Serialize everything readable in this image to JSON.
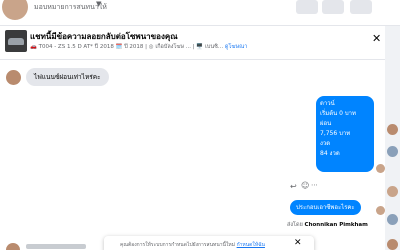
{
  "topbar": {
    "profile_name": "มอบหมายการสนทนาให้",
    "caret": "▼"
  },
  "header": {
    "title": "แชทนี้มีข้อความลอยกลับต่อโซพนาของคุณ",
    "subtitle": "🚗 T004 - ZS 1.5 D AT* ปี 2018 🗓️ ปี 2018 | ◎ เกือบัลงโฆษ ... | 🖥️ เบนซิ...",
    "view_link": "ดูโฆษณา",
    "close_icon": "close-icon"
  },
  "messages": {
    "incoming_1": "ไฟแนนซ์ผ่อนเท่าไหร่คะ",
    "outgoing_lines": [
      "ดาวน์",
      "เริ่มต้น 0 บาท",
      "ผ่อน",
      "7,756 บาท",
      "งวด",
      "84 งวด"
    ],
    "outgoing_2": "ประกอบเอาซีพอะไรคะ"
  },
  "sent_by": {
    "prefix": "ส่งโดย",
    "name": "Chonnikan Pimkham"
  },
  "notice": {
    "text": "คุณต้องการให้ระบบการกำหนดไปยังการสนทนานี้ใหม่",
    "link": "กำหนดให้ฉัน"
  },
  "colors": {
    "brand": "#1877f2",
    "bubble_out": "#0084ff",
    "bubble_in": "#e4e6eb"
  }
}
